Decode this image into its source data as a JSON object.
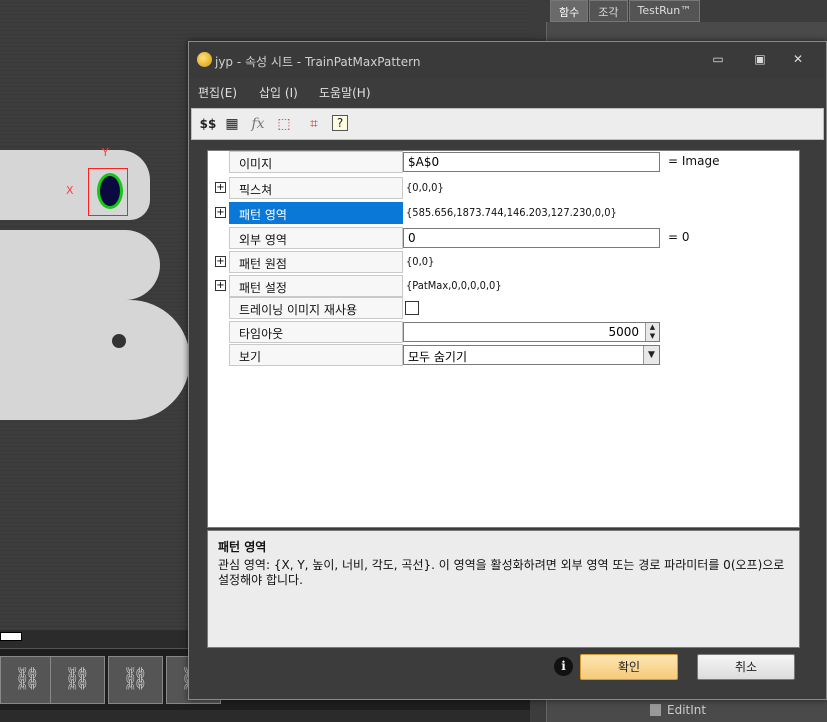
{
  "right_panel": {
    "tabs": [
      "함수",
      "조각",
      "TestRun™"
    ],
    "bottom_item": "EditInt"
  },
  "image_view": {
    "axis_x": "X",
    "axis_y": "Y"
  },
  "dialog": {
    "title": "jyp - 속성 시트 - TrainPatMaxPattern",
    "menu": [
      "편집(E)",
      "삽입 (I)",
      "도움말(H)"
    ],
    "toolbar_icons": [
      "expression-icon",
      "grid-icon",
      "function-icon",
      "select-region-icon",
      "fit-region-icon",
      "help-icon"
    ],
    "properties": [
      {
        "label": "이미지",
        "value": "$A$0",
        "suffix": "= Image",
        "kind": "input",
        "expander": false
      },
      {
        "label": "픽스쳐",
        "value": "{0,0,0}",
        "kind": "text",
        "expander": true
      },
      {
        "label": "패턴 영역",
        "value": "{585.656,1873.744,146.203,127.230,0,0}",
        "kind": "text",
        "expander": true,
        "selected": true
      },
      {
        "label": "외부 영역",
        "value": "0",
        "suffix": "= 0",
        "kind": "input",
        "expander": false
      },
      {
        "label": "패턴 원점",
        "value": "{0,0}",
        "kind": "text",
        "expander": true
      },
      {
        "label": "패턴 설정",
        "value": "{PatMax,0,0,0,0,0}",
        "kind": "text",
        "expander": true
      },
      {
        "label": "트레이닝 이미지 재사용",
        "value": "",
        "kind": "checkbox",
        "expander": false
      },
      {
        "label": "타임아웃",
        "value": "5000",
        "kind": "spin",
        "expander": false
      },
      {
        "label": "보기",
        "value": "모두 숨기기",
        "kind": "dropdown",
        "expander": false
      }
    ],
    "help": {
      "title": "패턴 영역",
      "body": "관심 영역: {X, Y, 높이, 너비, 각도, 곡선}. 이 영역을 활성화하려면 외부 영역 또는 경로 파라미터를 0(오프)으로 설정해야 합니다."
    },
    "buttons": {
      "ok": "확인",
      "cancel": "취소"
    },
    "win_buttons": {
      "minimize": "▭",
      "maximize": "▣",
      "close": "✕"
    }
  },
  "accent_color": "#0a78d7"
}
